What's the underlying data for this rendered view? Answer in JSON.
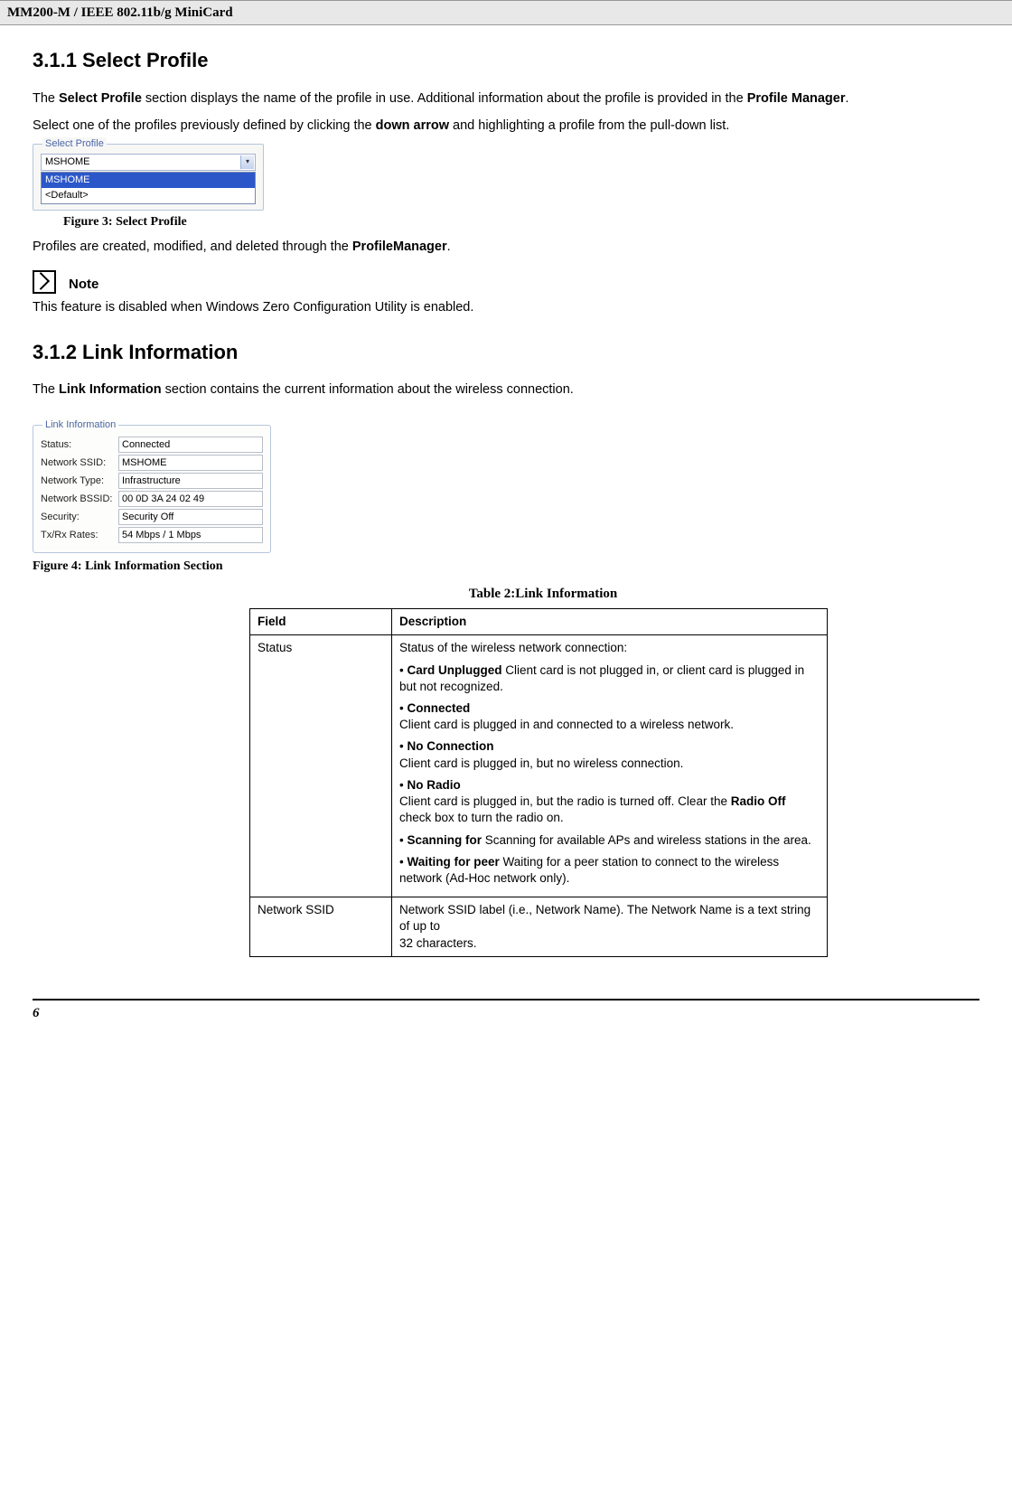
{
  "header": {
    "title": "MM200-M / IEEE 802.11b/g MiniCard"
  },
  "section311": {
    "heading": "3.1.1 Select Profile",
    "para1a": "The ",
    "para1b": "Select Profile",
    "para1c": " section displays the name of the profile in use. Additional information about the profile is provided in the ",
    "para1d": "Profile Manager",
    "para1e": ".",
    "para2a": "Select one of the profiles previously defined by clicking the ",
    "para2b": "down arrow",
    "para2c": " and highlighting a profile from the pull-down list.",
    "fig_legend": "Select Profile",
    "combo_value": "MSHOME",
    "combo_item_sel": "MSHOME",
    "combo_item_default": "<Default>",
    "fig_caption": "Figure 3: Select Profile",
    "para3a": "Profiles are created, modified, and deleted through the ",
    "para3b": "ProfileManager",
    "para3c": ".",
    "note_label": "Note",
    "note_text": "This feature is disabled when Windows Zero Configuration Utility is enabled."
  },
  "section312": {
    "heading": "3.1.2 Link Information",
    "para1a": "The ",
    "para1b": "Link Information",
    "para1c": " section contains the current information about the wireless connection.",
    "fig_legend": "Link Information",
    "rows": [
      {
        "label": "Status:",
        "value": "Connected"
      },
      {
        "label": "Network SSID:",
        "value": "MSHOME"
      },
      {
        "label": "Network Type:",
        "value": "Infrastructure"
      },
      {
        "label": "Network BSSID:",
        "value": "00 0D 3A 24 02 49"
      },
      {
        "label": "Security:",
        "value": "Security Off"
      },
      {
        "label": "Tx/Rx Rates:",
        "value": "54 Mbps / 1 Mbps"
      }
    ],
    "fig_caption": "Figure 4: Link Information Section",
    "table_title": "Table 2:Link Information",
    "table": {
      "header_field": "Field",
      "header_desc": "Description",
      "status_label": "Status",
      "status_intro": "Status of the wireless network connection:",
      "b1_bold": "Card Unplugged",
      "b1_rest": " Client card is not plugged in, or client card is plugged in but not recognized.",
      "b2_bold": "Connected",
      "b2_rest": "Client card is plugged in and connected to a wireless network.",
      "b3_bold": "No Connection",
      "b3_rest": "Client card is plugged in, but no wireless connection.",
      "b4_bold": "No Radio",
      "b4_rest_a": "Client card is plugged in, but the radio is turned off. Clear the ",
      "b4_rest_b": "Radio Off",
      "b4_rest_c": " check box to turn the radio on.",
      "b5_bold": "Scanning for",
      "b5_rest": " Scanning for available APs and wireless stations in the area.",
      "b6_bold": "Waiting for peer",
      "b6_rest": " Waiting for a peer station to connect to the wireless network (Ad-Hoc network only).",
      "ssid_label": "Network SSID",
      "ssid_desc": "Network SSID label (i.e., Network Name). The Network Name is a text string of up to\n32 characters."
    }
  },
  "footer": {
    "page": "6"
  }
}
